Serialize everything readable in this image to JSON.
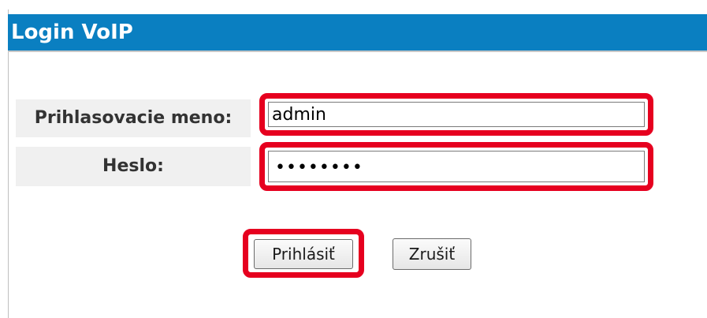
{
  "title": "Login VoIP",
  "form": {
    "username_label": "Prihlasovacie meno:",
    "username_value": "admin",
    "password_label": "Heslo:",
    "password_masked": "••••••••"
  },
  "buttons": {
    "login_label": "Prihlásiť",
    "cancel_label": "Zrušiť"
  },
  "colors": {
    "title_bar": "#0a7fc1",
    "highlight": "#e6001f"
  }
}
